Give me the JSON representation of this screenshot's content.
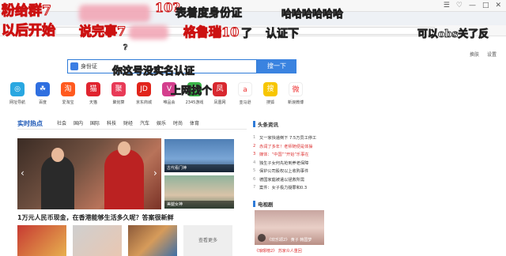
{
  "chrome": {
    "window_buttons": [
      "☰",
      "♡",
      "—",
      "□",
      "✕"
    ]
  },
  "danmaku": [
    {
      "text": "粉给群7",
      "size": 17
    },
    {
      "text": "10?",
      "size": 16
    },
    {
      "text": "表着度身份证",
      "size": 14
    },
    {
      "text": "哈哈哈哈哈哈",
      "size": 13
    },
    {
      "text": "以后开始",
      "size": 17
    },
    {
      "text": "可以",
      "size": 17
    },
    {
      "text": "说完事7",
      "size": 16
    },
    {
      "text": "格鲁瑞10",
      "size": 16
    },
    {
      "text": "了",
      "size": 14
    },
    {
      "text": "认证下",
      "size": 14
    },
    {
      "text": "可以obs关了反",
      "size": 13
    },
    {
      "text": "?",
      "size": 9
    },
    {
      "text": "你这号没实名认证",
      "size": 13
    },
    {
      "text": "上网找个",
      "size": 13
    }
  ],
  "search": {
    "value": "身份证",
    "button_label": "搜一下"
  },
  "top_right_links": [
    "换肤",
    "设置"
  ],
  "colors": {
    "accent": "#3a83e0",
    "hot_blue": "#1a56b5",
    "news_red": "#d33333"
  },
  "icon_grid": [
    {
      "label": "网址导航",
      "icon": "nav-icon",
      "color": "#29a7e1",
      "glyph": "◎"
    },
    {
      "label": "百度",
      "icon": "baidu-icon",
      "color": "#2f6fe0",
      "glyph": "☘"
    },
    {
      "label": "爱淘宝",
      "icon": "taobao-icon",
      "color": "#ff5a1f",
      "glyph": "淘"
    },
    {
      "label": "天猫",
      "icon": "tmall-icon",
      "color": "#e0242f",
      "glyph": "猫"
    },
    {
      "label": "聚划算",
      "icon": "juhuasuan-icon",
      "color": "#e83a57",
      "glyph": "聚"
    },
    {
      "label": "京东商城",
      "icon": "jd-icon",
      "color": "#e1251b",
      "glyph": "JD"
    },
    {
      "label": "唯品会",
      "icon": "vip-icon",
      "color": "#d43f8d",
      "glyph": "V"
    },
    {
      "label": "2345游戏",
      "icon": "game-icon",
      "color": "#3bb54a",
      "glyph": "✚"
    },
    {
      "label": "凤凰网",
      "icon": "ifeng-icon",
      "color": "#d8282f",
      "glyph": "凤"
    },
    {
      "label": "亚马逊",
      "icon": "amazon-icon",
      "color": "#ffffff",
      "glyph": "a"
    },
    {
      "label": "搜狐",
      "icon": "sohu-icon",
      "color": "#f7c600",
      "glyph": "搜"
    },
    {
      "label": "新浪微博",
      "icon": "weibo-icon",
      "color": "#ffffff",
      "glyph": "微"
    }
  ],
  "news": {
    "hot_label": "实时热点",
    "tabs": [
      "社会",
      "国内",
      "国际",
      "科技",
      "财经",
      "汽车",
      "娱乐",
      "时尚",
      "体育"
    ],
    "photo_captions": [
      "古代看门神",
      "美腿女神"
    ],
    "headline": "1万元人民币现金，在香港能够生活多久呢？答案很新鲜",
    "thumb_more": "查看更多"
  },
  "toutiao": {
    "title": "头条资讯",
    "items": [
      {
        "n": "1",
        "text": "又一家快递倒下 7.5万员工停工",
        "red": false
      },
      {
        "n": "2",
        "text": "赤润了多年！老师随便是体操",
        "red": true
      },
      {
        "n": "3",
        "text": "媒体：“中国”“开始”乐事在",
        "red": true
      },
      {
        "n": "4",
        "text": "独生子女何先抢到养老保障",
        "red": false
      },
      {
        "n": "5",
        "text": "保护公司股权以上收购事件",
        "red": false
      },
      {
        "n": "6",
        "text": "德国家庭被遣以拯救所需",
        "red": false
      },
      {
        "n": "7",
        "text": "案件：女子极力疑罪和0.3",
        "red": false
      }
    ]
  },
  "tv": {
    "title": "电视剧",
    "caption": "《欢乐颂2》 黄子 韩国梦",
    "sub": "《琅琊榜2》 苏家众人重回"
  }
}
